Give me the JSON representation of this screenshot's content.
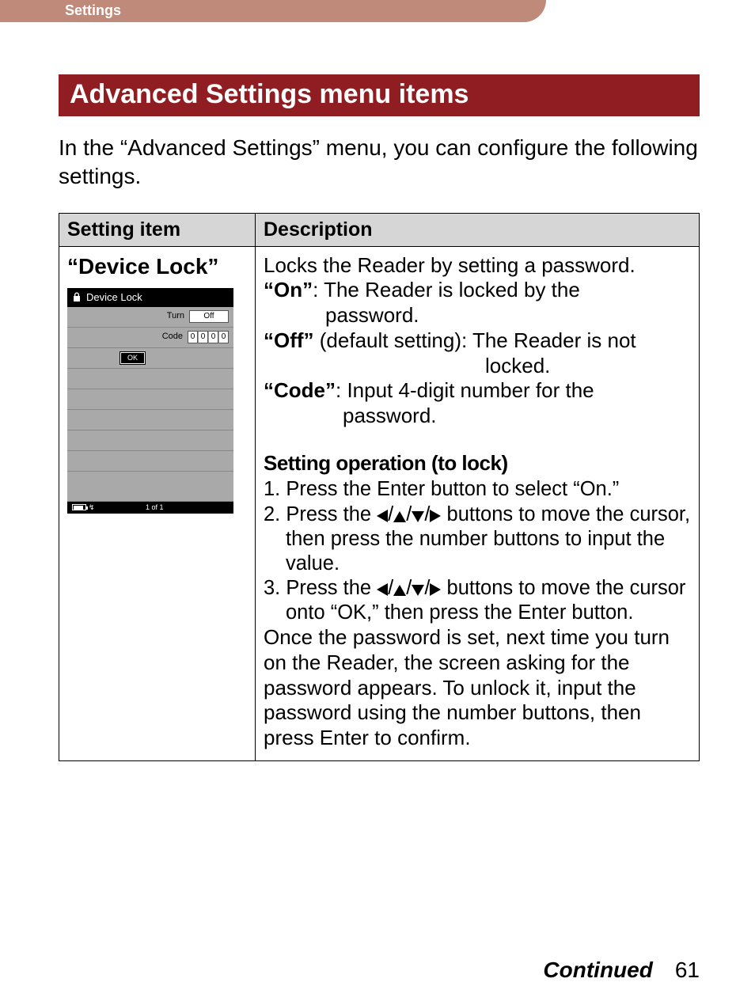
{
  "header": {
    "section": "Settings"
  },
  "title": "Advanced Settings menu items",
  "intro": "In the “Advanced Settings” menu, you can configure the following settings.",
  "table": {
    "col_item": "Setting item",
    "col_desc": "Description"
  },
  "device_lock": {
    "name": "“Device Lock”",
    "screenshot": {
      "title": "Device Lock",
      "turn_label": "Turn",
      "turn_value": "Off",
      "code_label": "Code",
      "code_digits": [
        "0",
        "0",
        "0",
        "0"
      ],
      "ok": "OK",
      "page": "1 of 1"
    },
    "desc": {
      "line1": "Locks the Reader by setting a password.",
      "on_label": "“On”",
      "on_text": ": The Reader is locked by the",
      "on_text2": "password.",
      "off_label": "“Off”",
      "off_text": " (default setting): The Reader is not",
      "off_text2": "locked.",
      "code_label": "“Code”",
      "code_text": ": Input 4-digit number for the",
      "code_text2": "password.",
      "operation_heading": "Setting operation (to lock)",
      "step1": "1. Press the Enter button to select “On.”",
      "step2a": "2. Press the ",
      "step2b": " buttons to move the cursor, then press the number buttons to input the value.",
      "step3a": "3. Press the ",
      "step3b": " buttons to move the cursor onto “OK,” then press the Enter button.",
      "after": "Once the password is set, next time you turn on the Reader, the screen asking for the password appears. To unlock it, input the password using the number buttons, then press Enter to confirm."
    }
  },
  "footer": {
    "continued": "Continued",
    "page": "61"
  }
}
